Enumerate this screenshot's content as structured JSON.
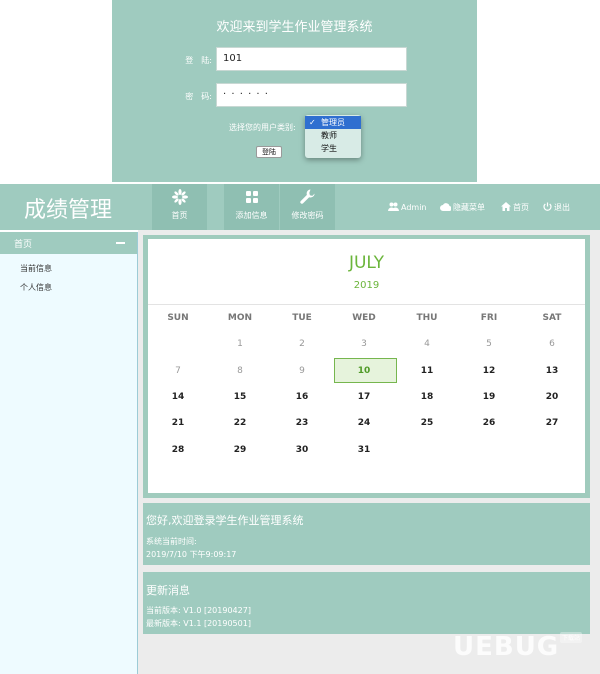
{
  "login": {
    "title": "欢迎来到学生作业管理系统",
    "username_label": "登　陆:",
    "username_value": "101",
    "password_label": "密　码:",
    "password_value": "· · · · · ·",
    "role_label": "选择您的用户类别:",
    "role_options": [
      "管理员",
      "教师",
      "学生"
    ],
    "role_selected": "管理员",
    "submit_label": "登陆"
  },
  "header": {
    "brand": "成绩管理",
    "nav": [
      {
        "label": "首页",
        "icon": "flower-icon"
      },
      {
        "label": "添加信息",
        "icon": "grid-icon"
      },
      {
        "label": "修改密码",
        "icon": "wrench-icon"
      }
    ],
    "user": "Admin",
    "hide_menu": "隐藏菜单",
    "home": "首页",
    "logout": "退出"
  },
  "sidebar": {
    "title": "首页",
    "items": [
      "当前信息",
      "个人信息"
    ]
  },
  "calendar": {
    "month": "JULY",
    "year": "2019",
    "weekdays": [
      "SUN",
      "MON",
      "TUE",
      "WED",
      "THU",
      "FRI",
      "SAT"
    ],
    "today": "10",
    "rows": [
      [
        "",
        "1",
        "2",
        "3",
        "4",
        "5",
        "6"
      ],
      [
        "7",
        "8",
        "9",
        "10",
        "11",
        "12",
        "13"
      ],
      [
        "14",
        "15",
        "16",
        "17",
        "18",
        "19",
        "20"
      ],
      [
        "21",
        "22",
        "23",
        "24",
        "25",
        "26",
        "27"
      ],
      [
        "28",
        "29",
        "30",
        "31",
        "",
        "",
        ""
      ]
    ]
  },
  "welcome": {
    "title": "您好,欢迎登录学生作业管理系统",
    "time_label": "系统当前时间:",
    "time_value": "2019/7/10 下午9:09:17"
  },
  "updates": {
    "title": "更新消息",
    "current": "当前版本: V1.0 [20190427]",
    "latest": "最新版本: V1.1 [20190501]"
  },
  "watermark": {
    "text": "UEBUG",
    "sub": "下载站"
  },
  "colors": {
    "primary": "#9fcbbf",
    "accent": "#6bb53b",
    "selected": "#2f6fd0"
  }
}
